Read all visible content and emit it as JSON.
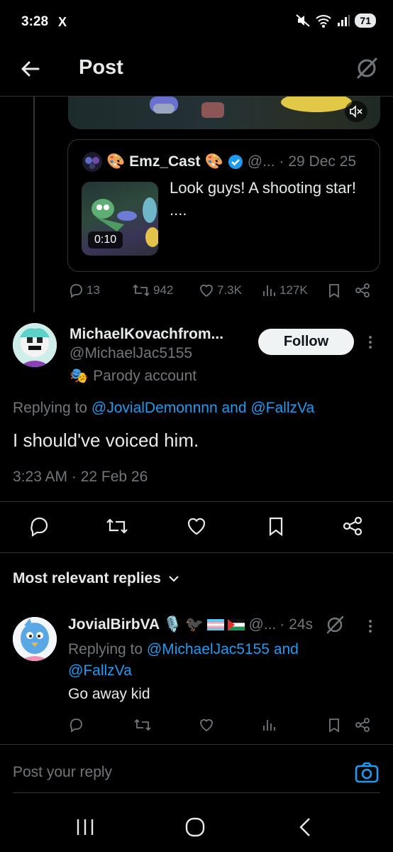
{
  "status_bar": {
    "time": "3:28",
    "app_icon": "X",
    "battery": "71"
  },
  "header": {
    "title": "Post"
  },
  "quoted_post": {
    "display_name": "Emz_Cast",
    "handle": "@...",
    "date": "· 29 Dec 25",
    "text": "Look guys! A shooting star!",
    "text_more": "....",
    "video_duration": "0:10"
  },
  "parent_actions": {
    "replies": "13",
    "reposts": "942",
    "likes": "7.3K",
    "views": "127K"
  },
  "main_post": {
    "display_name": "MichaelKovachfrom...",
    "handle": "@MichaelJac5155",
    "label": "Parody account",
    "follow_label": "Follow",
    "replying_prefix": "Replying to",
    "replying_to": "@JovialDemonnnn and @FallzVa",
    "text": "I should've voiced him.",
    "timestamp": "3:23 AM · 22 Feb 26"
  },
  "replies_section": {
    "sort_label": "Most relevant replies"
  },
  "reply": {
    "display_name": "JovialBirbVA",
    "handle": "@...",
    "time": "· 24s",
    "replying_prefix": "Replying to",
    "replying_to": "@MichaelJac5155 and @FallzVa",
    "text": "Go away kid"
  },
  "composer": {
    "placeholder": "Post your reply"
  },
  "colors": {
    "background": "#000000",
    "accent": "#1d9bf0",
    "muted": "#71767b",
    "text": "#e7e9ea",
    "divider": "#2f3336"
  }
}
